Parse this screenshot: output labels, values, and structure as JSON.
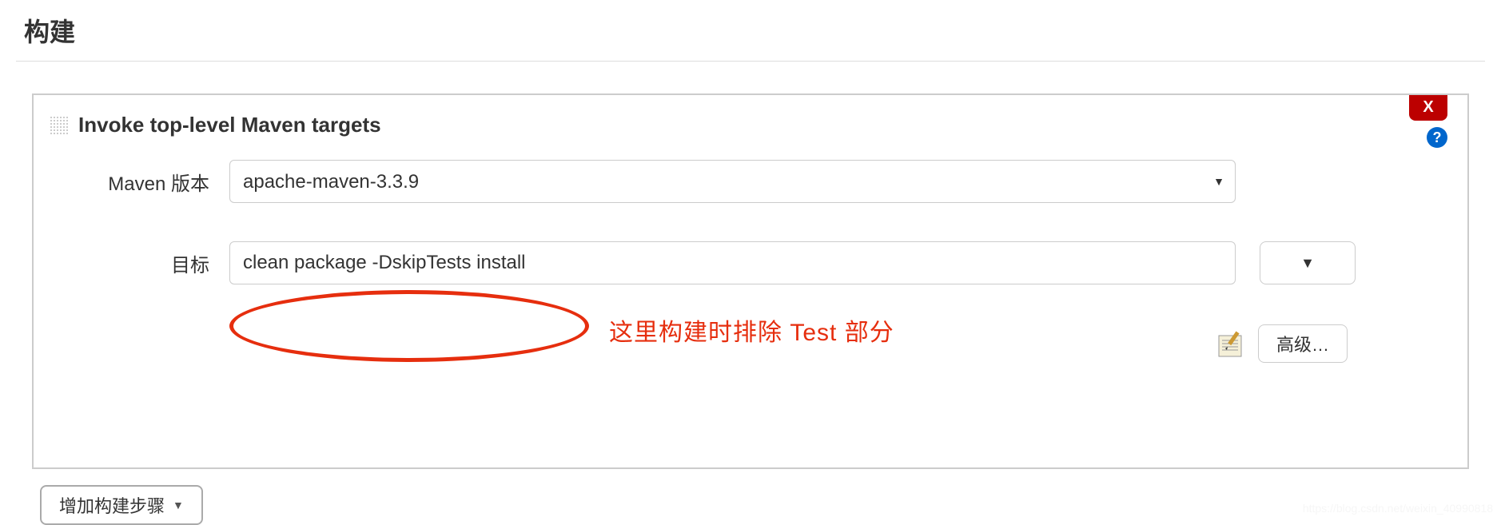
{
  "section": {
    "title": "构建"
  },
  "panel": {
    "title": "Invoke top-level Maven targets",
    "close_label": "X",
    "help_label": "?"
  },
  "form": {
    "maven_version_label": "Maven 版本",
    "maven_version_value": "apache-maven-3.3.9",
    "goals_label": "目标",
    "goals_value": "clean package -DskipTests install",
    "expand_label": "▼",
    "advanced_label": "高级…"
  },
  "annotation": {
    "text": "这里构建时排除 Test 部分"
  },
  "footer": {
    "add_step_label": "增加构建步骤",
    "add_step_chevron": "▼"
  },
  "watermark": "https://blog.csdn.net/weixin_40990818"
}
